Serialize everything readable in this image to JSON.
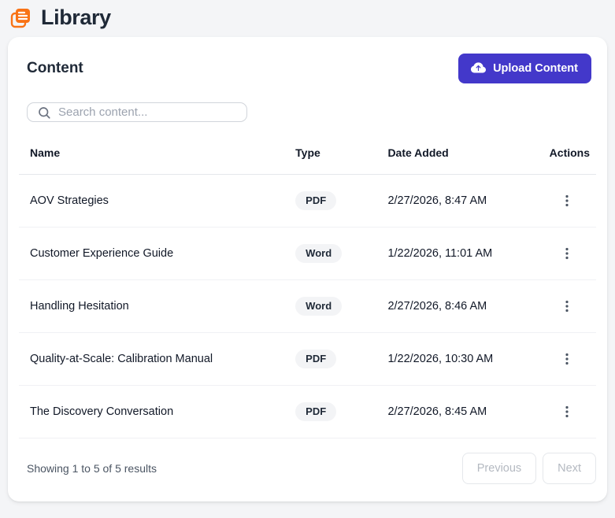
{
  "page": {
    "title": "Library"
  },
  "card": {
    "heading": "Content",
    "upload_button_label": "Upload Content",
    "search": {
      "placeholder": "Search content..."
    },
    "table": {
      "columns": [
        "Name",
        "Type",
        "Date Added",
        "Actions"
      ],
      "rows": [
        {
          "name": "AOV Strategies",
          "type": "PDF",
          "date": "2/27/2026, 8:47 AM"
        },
        {
          "name": "Customer Experience Guide",
          "type": "Word",
          "date": "1/22/2026, 11:01 AM"
        },
        {
          "name": "Handling Hesitation",
          "type": "Word",
          "date": "2/27/2026, 8:46 AM"
        },
        {
          "name": "Quality-at-Scale: Calibration Manual",
          "type": "PDF",
          "date": "1/22/2026, 10:30 AM"
        },
        {
          "name": "The Discovery Conversation",
          "type": "PDF",
          "date": "2/27/2026, 8:45 AM"
        }
      ]
    },
    "footer": {
      "summary": "Showing 1 to 5 of 5 results",
      "previous_label": "Previous",
      "next_label": "Next"
    }
  },
  "icons": {
    "header": "library-icon",
    "upload": "cloud-upload-icon",
    "search": "search-icon",
    "row_actions": "kebab-menu-icon"
  },
  "colors": {
    "accent": "#4338ca",
    "brand_orange": "#f97316",
    "badge_bg": "#f3f4f6",
    "page_bg": "#f4f5f7"
  }
}
